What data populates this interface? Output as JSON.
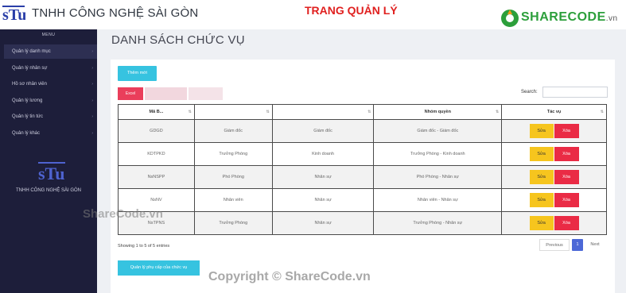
{
  "header": {
    "company": "TNHH CÔNG NGHỆ SÀI GÒN",
    "title": "TRANG QUẢN LÝ",
    "sharecode": "SHARECODE",
    "sharecode_suffix": ".vn",
    "logo_text": "STU"
  },
  "sidebar": {
    "menu_title": "MENU",
    "items": [
      {
        "label": "Quản lý danh mục"
      },
      {
        "label": "Quản lý nhân sự"
      },
      {
        "label": "Hồ sơ nhân viên"
      },
      {
        "label": "Quản lý lương"
      },
      {
        "label": "Quản lý tin tức"
      },
      {
        "label": "Quản lý khác"
      }
    ],
    "company": "TNHH CÔNG NGHỆ SÀI GÒN"
  },
  "main": {
    "title": "DANH SÁCH CHỨC VỤ",
    "add_label": "Thêm mới",
    "export": {
      "excel": "Excel"
    },
    "search_label": "Search:",
    "search_value": "",
    "columns": [
      "Mã B...",
      "",
      "",
      "Nhóm quyền",
      "Tác vụ"
    ],
    "rows": [
      [
        "GDGD",
        "Giám đốc",
        "Giám đốc",
        "Giám đốc - Giám đốc"
      ],
      [
        "KDTPKD",
        "Trưởng Phòng",
        "Kinh doanh",
        "Trưởng Phòng - Kinh doanh"
      ],
      [
        "NsNSPP",
        "Phó Phòng",
        "Nhân sự",
        "Phó Phòng - Nhân sự"
      ],
      [
        "NsNV",
        "Nhân viên",
        "Nhân sự",
        "Nhân viên - Nhân sự"
      ],
      [
        "NsTPNS",
        "Trưởng Phòng",
        "Nhân sự",
        "Trưởng Phòng - Nhân sự"
      ]
    ],
    "edit_label": "Sửa",
    "delete_label": "Xóa",
    "showing": "Showing 1 to 5 of 5 entries",
    "pagination": {
      "previous": "Previous",
      "current": "1",
      "next": "Next"
    },
    "allowance_button": "Quản lý phụ cấp của chức vụ"
  },
  "watermarks": {
    "left": "ShareCode.vn",
    "bottom": "Copyright © ShareCode.vn"
  },
  "colors": {
    "sidebar": "#1d1e3a",
    "accent_cyan": "#36c3e0",
    "edit_yellow": "#f6c51e",
    "delete_red": "#ea2b45",
    "title_red": "#e0201f",
    "brand_green": "#2c9f3b"
  }
}
